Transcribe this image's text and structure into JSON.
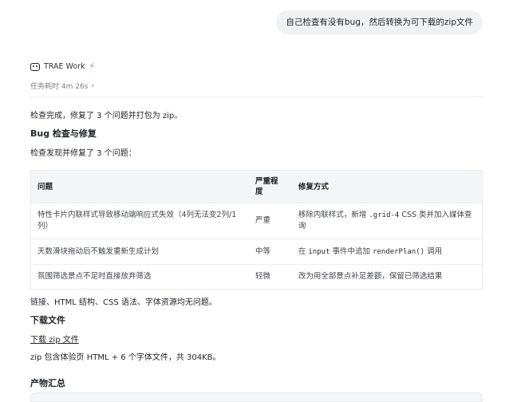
{
  "user_message": "自己检查有没有bug，然后转换为可下载的zip文件",
  "agent": {
    "name": "TRAE Work",
    "duration_label": "任务耗时 4m 26s",
    "chevron": "›"
  },
  "response": {
    "intro": "检查完成，修复了 3 个问题并打包为 zip。",
    "bug_heading": "Bug 检查与修复",
    "bug_intro": "检查发现并修复了 3 个问题：",
    "table": {
      "headers": [
        "问题",
        "严重程\n度",
        "修复方式"
      ],
      "rows": [
        {
          "issue_line1": "特性卡片内联样式导致移动端响应式失效（4列无法变2列/1",
          "issue_line2": "列）",
          "severity": "严重",
          "fix_pre": "移除内联样式，新增 ",
          "fix_code": ".grid-4",
          "fix_post": " CSS 类并加入媒体查",
          "fix_line2": "询"
        },
        {
          "issue": "天数滑块拖动后不触发重新生成计划",
          "severity": "中等",
          "fix_pre": "在 ",
          "fix_code": "input",
          "fix_mid": " 事件中追加 ",
          "fix_code2": "renderPlan()",
          "fix_post": " 调用"
        },
        {
          "issue": "氛围筛选景点不足时直接放弃筛选",
          "severity": "轻微",
          "fix": "改为用全部景点补足差额，保留已筛选结果"
        }
      ]
    },
    "summary": "链接、HTML 结构、CSS 语法、字体资源均无问题。",
    "download_heading": "下载文件",
    "download_link": "下载 zip 文件",
    "download_desc": "zip 包含体验页 HTML + 6 个字体文件，共 304KB。",
    "output_heading": "产物汇总"
  }
}
